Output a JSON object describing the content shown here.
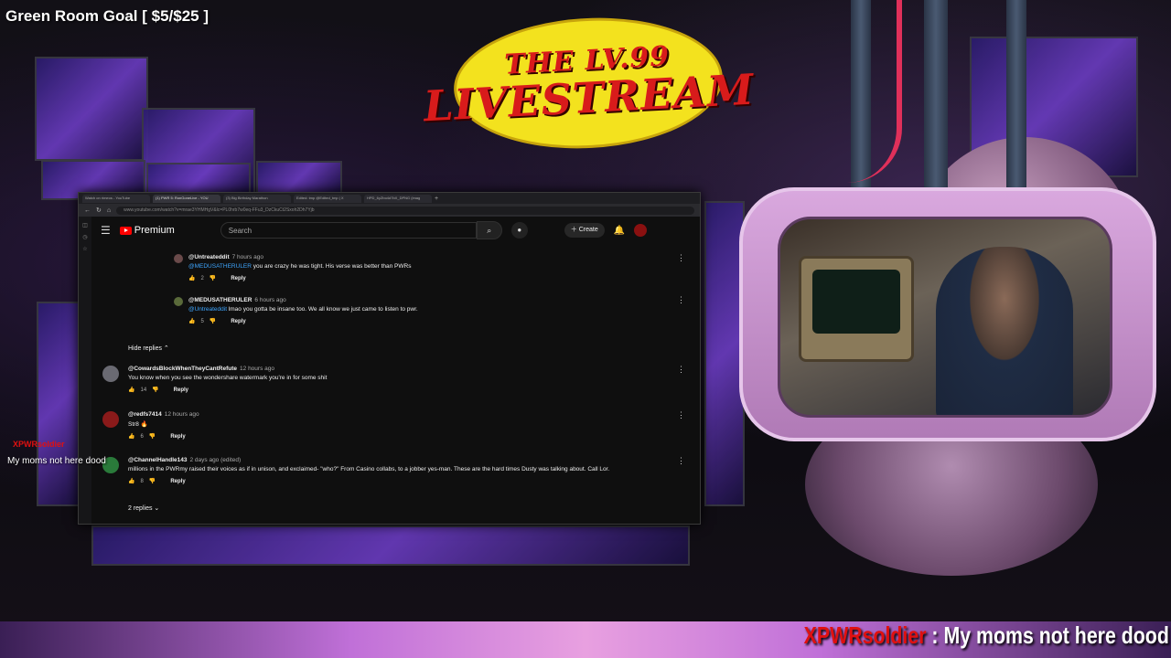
{
  "overlay": {
    "goal_text": "Green Room Goal [ $5/$25 ]",
    "logo_line1": "THE LV.99",
    "logo_line2": "LIVESTREAM"
  },
  "chat": {
    "side_name": "XPWRsoldier",
    "side_message": "My moms not here dood",
    "bottom_name": "XPWRsoldier",
    "bottom_separator": ":",
    "bottom_message": "My moms not here dood"
  },
  "browser": {
    "tabs": [
      "Watch on rimeos - YouTube",
      "(1) PWR 5: RonGoneLive - YOU",
      "(3) Big Birthday Marathon",
      "Edited: tmp @Edited_tmp | X",
      "HPD_6yZbo4d7bX_DPNG (imag"
    ],
    "url": "www.youtube.com/watch?v=mrae3YHMHgV&lc=PL0hrb7w0eq-FFu3_DzCkuCt2Sxoh2Dh7Yjb"
  },
  "youtube": {
    "brand": "Premium",
    "search_placeholder": "Search",
    "create_label": "Create",
    "reply_label": "Reply",
    "hide_replies_label": "Hide replies",
    "more_replies_label": "2 replies",
    "comments": [
      {
        "author": "@Untreateddit",
        "time": "7 hours ago",
        "mention": "@MEDUSATHERULER",
        "text": " you are crazy he was tight. His verse was better than PWRs",
        "likes": "2"
      },
      {
        "author": "@MEDUSATHERULER",
        "time": "6 hours ago",
        "mention": "@Untreateddit",
        "text": " lmao you gotta be insane too. We all know we just came to listen to pwr.",
        "likes": "5"
      },
      {
        "author": "@CowardsBlockWhenTheyCantRefute",
        "time": "12 hours ago",
        "mention": "",
        "text": "You know when you see the wondershare watermark you're in for some shit",
        "likes": "14"
      },
      {
        "author": "@redfs7414",
        "time": "12 hours ago",
        "mention": "",
        "text": "Str8 🔥",
        "likes": "6"
      },
      {
        "author": "@ChannelHandle143",
        "time": "2 days ago (edited)",
        "mention": "",
        "text": "millions in the PWRmy raised their voices as if in unison, and exclaimed- \"who?\" From Casino collabs, to a jobber yes-man. These are the hard times Dusty was talking about. Call Lor.",
        "likes": "8"
      }
    ]
  },
  "colors": {
    "logo_yellow": "#f3e21e",
    "logo_red": "#d81b1b",
    "yt_red": "#ff0000",
    "mention_blue": "#3ea6ff",
    "chat_red": "#e01010"
  }
}
